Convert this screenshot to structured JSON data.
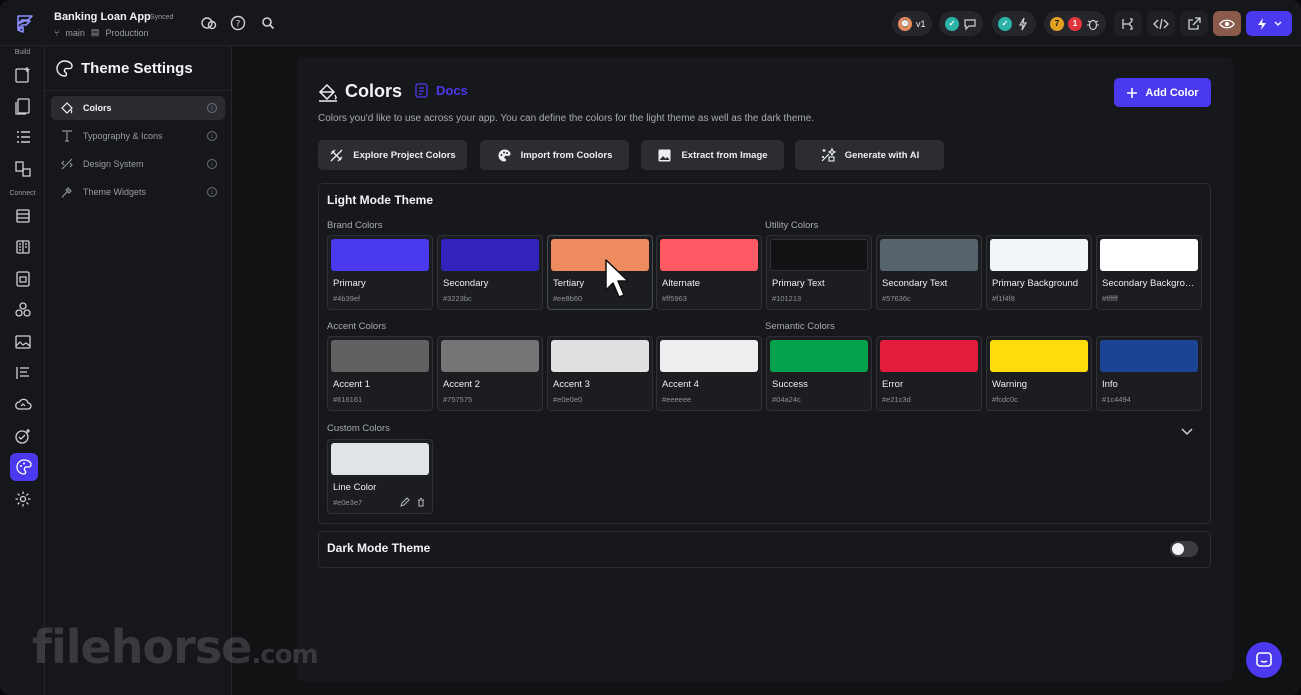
{
  "project": {
    "name": "Banking Loan App",
    "status": "Synced",
    "branch": "main",
    "environment": "Production"
  },
  "topbar": {
    "version": "v1",
    "warning_count": "7",
    "error_count": "1"
  },
  "rail": {
    "build_label": "Build",
    "connect_label": "Connect"
  },
  "sidebar": {
    "title": "Theme Settings",
    "items": [
      {
        "label": "Colors",
        "icon": "paint-bucket-icon"
      },
      {
        "label": "Typography & Icons",
        "icon": "typography-icon"
      },
      {
        "label": "Design System",
        "icon": "design-system-icon"
      },
      {
        "label": "Theme Widgets",
        "icon": "widgets-icon"
      }
    ]
  },
  "header": {
    "title": "Colors",
    "docs_label": "Docs",
    "description": "Colors you'd like to use across your app. You can define the colors for the light theme as well as the dark theme.",
    "add_button": "Add Color"
  },
  "actions": [
    {
      "label": "Explore Project Colors",
      "icon": "explore-icon"
    },
    {
      "label": "Import from Coolors",
      "icon": "palette-icon"
    },
    {
      "label": "Extract from Image",
      "icon": "image-icon"
    },
    {
      "label": "Generate with AI",
      "icon": "ai-sparkle-icon"
    }
  ],
  "light_theme": {
    "title": "Light Mode Theme",
    "brand_label": "Brand Colors",
    "utility_label": "Utility Colors",
    "accent_label": "Accent Colors",
    "semantic_label": "Semantic Colors",
    "custom_label": "Custom Colors",
    "brand": [
      {
        "name": "Primary",
        "hex": "#4b39ef"
      },
      {
        "name": "Secondary",
        "hex": "#3223bc"
      },
      {
        "name": "Tertiary",
        "hex": "#ee8b60"
      },
      {
        "name": "Alternate",
        "hex": "#ff5963"
      }
    ],
    "utility": [
      {
        "name": "Primary Text",
        "hex": "#101213"
      },
      {
        "name": "Secondary Text",
        "hex": "#57636c"
      },
      {
        "name": "Primary Background",
        "hex": "#f1f4f8"
      },
      {
        "name": "Secondary Background",
        "hex": "#ffffff"
      }
    ],
    "accent": [
      {
        "name": "Accent 1",
        "hex": "#616161"
      },
      {
        "name": "Accent 2",
        "hex": "#757575"
      },
      {
        "name": "Accent 3",
        "hex": "#e0e0e0"
      },
      {
        "name": "Accent 4",
        "hex": "#eeeeee"
      }
    ],
    "semantic": [
      {
        "name": "Success",
        "hex": "#04a24c"
      },
      {
        "name": "Error",
        "hex": "#e21c3d"
      },
      {
        "name": "Warning",
        "hex": "#fcdc0c"
      },
      {
        "name": "Info",
        "hex": "#1c4494"
      }
    ],
    "custom": [
      {
        "name": "Line Color",
        "hex": "#e0e3e7"
      }
    ]
  },
  "dark_theme": {
    "title": "Dark Mode Theme",
    "enabled": false
  },
  "watermark": {
    "text": "filehorse",
    "suffix": ".com"
  }
}
